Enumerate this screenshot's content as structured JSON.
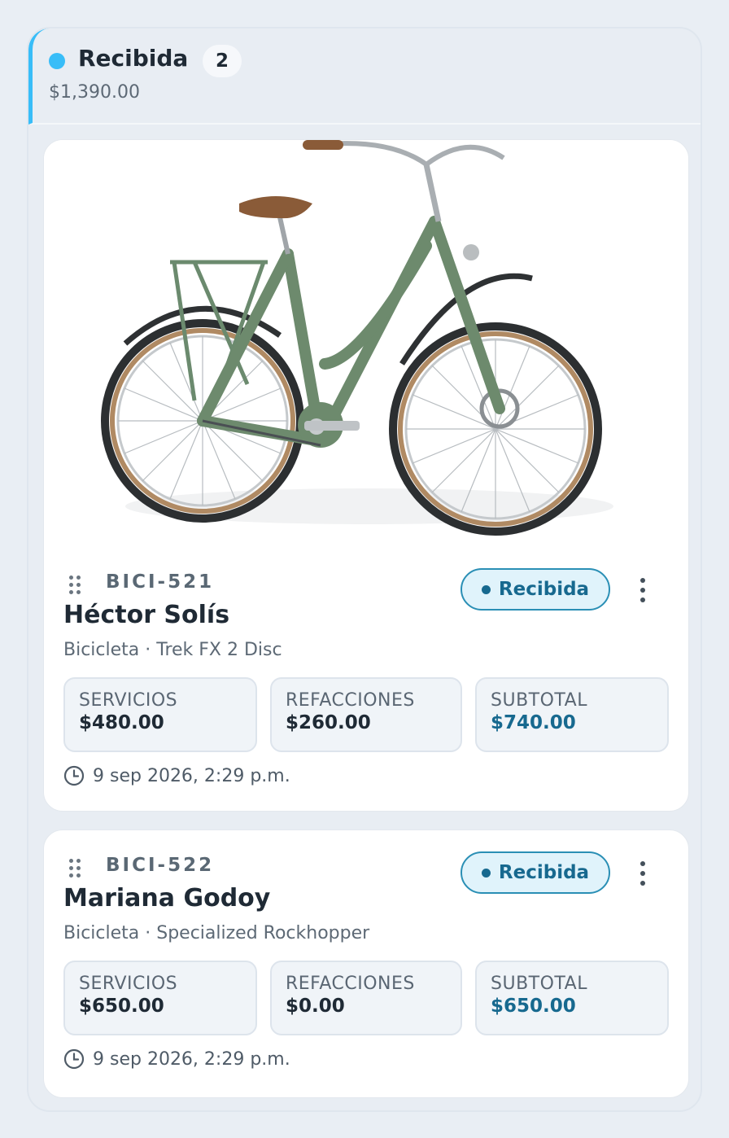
{
  "column": {
    "title": "Recibida",
    "count": "2",
    "total": "$1,390.00",
    "accent": "#38bdf8"
  },
  "cards": [
    {
      "has_photo": true,
      "photo": "green city bicycle",
      "code": "BICI-521",
      "status": "Recibida",
      "name": "Héctor Solís",
      "subtitle": "Bicicleta · Trek FX 2 Disc",
      "stats": [
        {
          "label": "SERVICIOS",
          "value": "$480.00"
        },
        {
          "label": "REFACCIONES",
          "value": "$260.00"
        },
        {
          "label": "SUBTOTAL",
          "value": "$740.00"
        }
      ],
      "timestamp": "9 sep 2026, 2:29 p.m."
    },
    {
      "has_photo": false,
      "code": "BICI-522",
      "status": "Recibida",
      "name": "Mariana Godoy",
      "subtitle": "Bicicleta · Specialized Rockhopper",
      "stats": [
        {
          "label": "SERVICIOS",
          "value": "$650.00"
        },
        {
          "label": "REFACCIONES",
          "value": "$0.00"
        },
        {
          "label": "SUBTOTAL",
          "value": "$650.00"
        }
      ],
      "timestamp": "9 sep 2026, 2:29 p.m."
    }
  ],
  "icons": {
    "status_dot": "circle",
    "drag": "grip-vertical-icon",
    "menu": "more-vertical-icon",
    "time": "clock-icon"
  }
}
